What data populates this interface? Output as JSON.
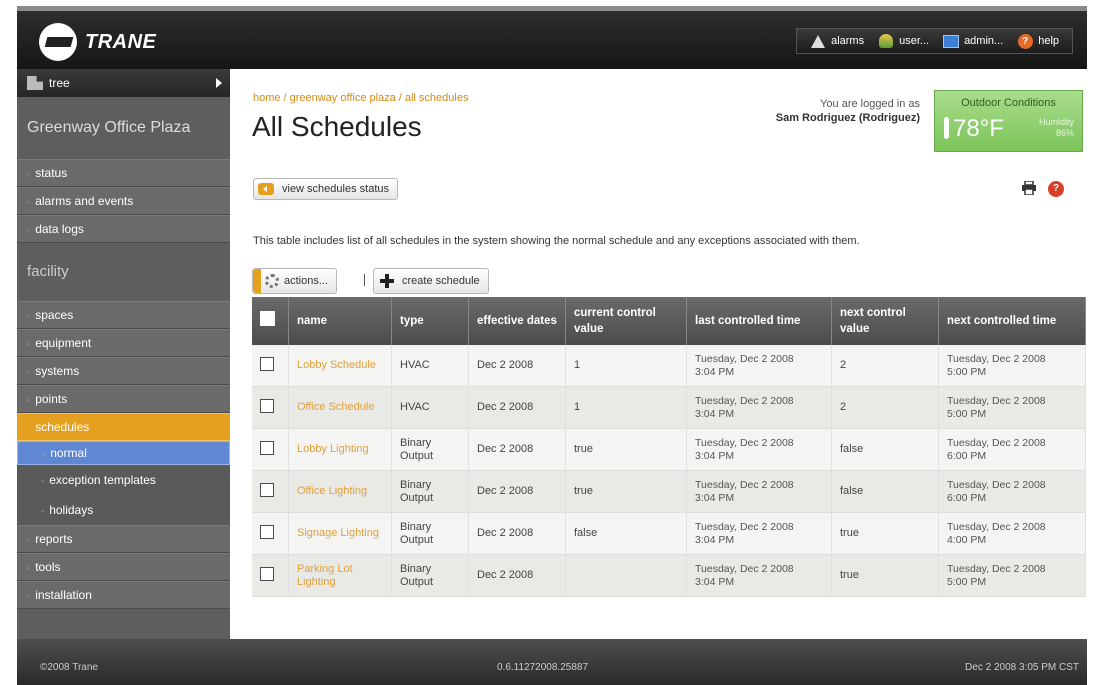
{
  "brand": {
    "name": "TRANE"
  },
  "topnav": {
    "alarms": "alarms",
    "user": "user...",
    "admin": "admin...",
    "help": "help"
  },
  "sidebar": {
    "tree_label": "tree",
    "site_name": "Greenway Office Plaza",
    "group1": [
      "status",
      "alarms and events",
      "data logs"
    ],
    "facility_title": "facility",
    "group2": [
      "spaces",
      "equipment",
      "systems",
      "points"
    ],
    "schedules": "schedules",
    "sub": [
      "normal",
      "exception templates",
      "holidays"
    ],
    "group3": [
      "reports",
      "tools",
      "installation"
    ]
  },
  "breadcrumb": [
    "home",
    "/",
    "greenway office plaza",
    "/",
    "all schedules"
  ],
  "page_title": "All Schedules",
  "login": {
    "line1": "You are logged in as",
    "line2": "Sam Rodriguez (Rodriguez)"
  },
  "outdoor": {
    "title": "Outdoor Conditions",
    "temp": "78°F",
    "humidity_label": "Humidity",
    "humidity_value": "86%"
  },
  "view_status_label": "view schedules status",
  "description": "This table includes list of all schedules in the system showing the normal schedule and any exceptions associated with them.",
  "actions_label": "actions...",
  "separator": "|",
  "create_label": "create schedule",
  "table": {
    "headers": [
      "name",
      "type",
      "effective dates",
      "current control value",
      "last controlled time",
      "next control value",
      "next controlled time"
    ],
    "rows": [
      {
        "name": "Lobby Schedule",
        "type": "HVAC",
        "dates": "Dec 2 2008",
        "current": "1",
        "last": "Tuesday, Dec 2 2008",
        "last_time": "3:04 PM",
        "next_val": "2",
        "next": "Tuesday, Dec 2 2008",
        "next_time": "5:00 PM"
      },
      {
        "name": "Office Schedule",
        "type": "HVAC",
        "dates": "Dec 2 2008",
        "current": "1",
        "last": "Tuesday, Dec 2 2008",
        "last_time": "3:04 PM",
        "next_val": "2",
        "next": "Tuesday, Dec 2 2008",
        "next_time": "5:00 PM"
      },
      {
        "name": "Lobby Lighting",
        "type": "Binary Output",
        "dates": "Dec 2 2008",
        "current": "true",
        "last": "Tuesday, Dec 2 2008",
        "last_time": "3:04 PM",
        "next_val": "false",
        "next": "Tuesday, Dec 2 2008",
        "next_time": "6:00 PM"
      },
      {
        "name": "Office Lighting",
        "type": "Binary Output",
        "dates": "Dec 2 2008",
        "current": "true",
        "last": "Tuesday, Dec 2 2008",
        "last_time": "3:04 PM",
        "next_val": "false",
        "next": "Tuesday, Dec 2 2008",
        "next_time": "6:00 PM"
      },
      {
        "name": "Signage Lighting",
        "type": "Binary Output",
        "dates": "Dec 2 2008",
        "current": "false",
        "last": "Tuesday, Dec 2 2008",
        "last_time": "3:04 PM",
        "next_val": "true",
        "next": "Tuesday, Dec 2 2008",
        "next_time": "4:00 PM"
      },
      {
        "name": "Parking Lot Lighting",
        "type": "Binary Output",
        "dates": "Dec 2 2008",
        "current": "",
        "last": "Tuesday, Dec 2 2008",
        "last_time": "3:04 PM",
        "next_val": "true",
        "next": "Tuesday, Dec 2 2008",
        "next_time": "5:00 PM"
      }
    ]
  },
  "footer": {
    "copyright": "©2008 Trane",
    "version": "0.6.11272008.25887",
    "datetime": "Dec 2 2008 3:05 PM CST"
  },
  "colors": {
    "accent": "#e6a020",
    "link": "#e0a040",
    "selected_sub": "#5f87d3",
    "outdoor_green": "#7cc45a"
  },
  "icons": [
    "alarm-icon",
    "user-icon",
    "admin-icon",
    "help-icon",
    "tree-icon",
    "print-icon",
    "gear-icon",
    "plus-icon"
  ]
}
